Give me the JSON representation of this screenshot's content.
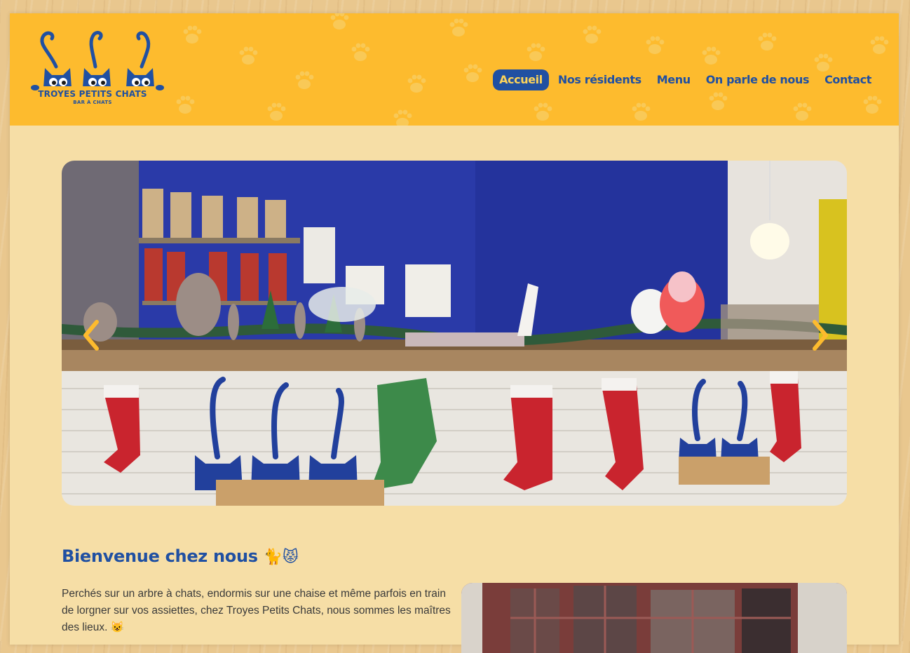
{
  "brand": {
    "name": "Troyes Petits Chats",
    "logo_title": "TROYES PETITS CHATS",
    "logo_subtitle": "BAR À CHATS"
  },
  "nav": {
    "items": [
      {
        "label": "Accueil",
        "active": true
      },
      {
        "label": "Nos résidents",
        "active": false
      },
      {
        "label": "Menu",
        "active": false
      },
      {
        "label": "On parle de nous",
        "active": false
      },
      {
        "label": "Contact",
        "active": false
      }
    ]
  },
  "carousel": {
    "prev_icon": "chevron-left-icon",
    "next_icon": "chevron-right-icon",
    "arrow_color": "#fdbb2e"
  },
  "welcome": {
    "title": "Bienvenue chez nous",
    "title_emoji": "🐈😾",
    "paragraph_line1": "Perchés sur un arbre à chats, endormis sur une chaise et même parfois en train de lorgner sur vos assiettes, chez Troyes Petits Chats, nous sommes les maîtres des lieux. 😺"
  },
  "colors": {
    "header_bg": "#fdbb2e",
    "brand_blue": "#2050a2",
    "page_bg": "#f6dea6"
  }
}
